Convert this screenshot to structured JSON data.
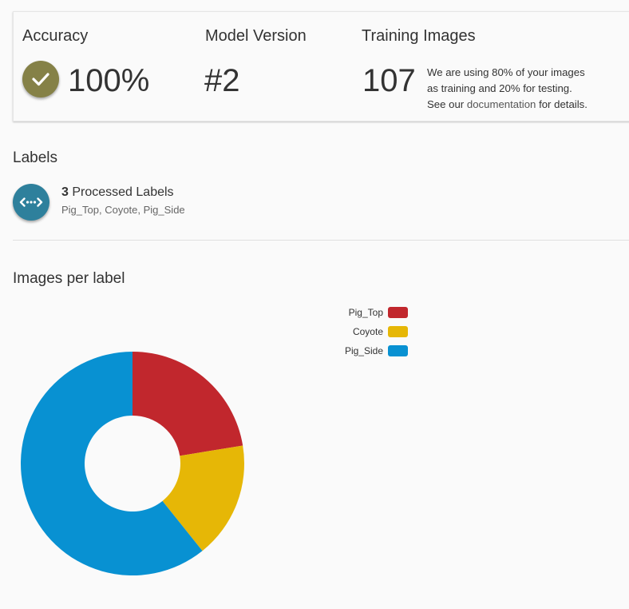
{
  "stats": {
    "accuracy": {
      "title": "Accuracy",
      "value": "100%"
    },
    "model_version": {
      "title": "Model Version",
      "value": "#2"
    },
    "training_images": {
      "title": "Training Images",
      "value": "107",
      "note_line1": "We are using 80% of your images",
      "note_line2": "as training and 20% for testing.",
      "note_see": "See our",
      "note_link": "documentation",
      "note_end": "for details."
    }
  },
  "labels": {
    "title": "Labels",
    "count": "3",
    "processed_text": "Processed Labels",
    "list": "Pig_Top, Coyote, Pig_Side"
  },
  "images_per_label": {
    "title": "Images per label"
  },
  "icons": {
    "accuracy_icon": "checkmark-icon",
    "labels_icon": "arrows-dots-icon"
  },
  "colors": {
    "accuracy_badge": "#858147",
    "labels_badge": "#2e809c",
    "pig_top": "#c1272d",
    "coyote": "#e6b706",
    "pig_side": "#0891d2"
  },
  "chart_data": {
    "type": "pie",
    "style": "doughnut",
    "categories": [
      "Pig_Top",
      "Coyote",
      "Pig_Side"
    ],
    "values": [
      24,
      18,
      65
    ],
    "colors": [
      "#c1272d",
      "#e6b706",
      "#0891d2"
    ],
    "legend_position": "top-right"
  }
}
